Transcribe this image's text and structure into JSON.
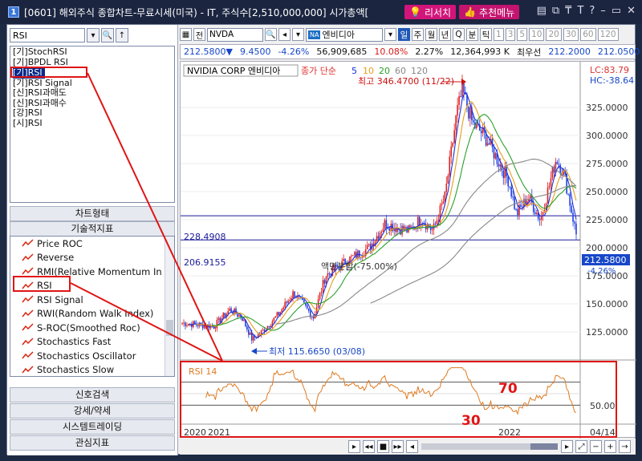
{
  "window": {
    "badge": "1",
    "title": "[0601] 해외주식 종합차트-무료시세(미국) - IT, 주식수[2,510,000,000] 시가총액[",
    "btn_research": "리서치",
    "btn_recommend": "추천메뉴",
    "icons": [
      "layout-icon",
      "copy-icon",
      "pin-icon",
      "text-size-icon",
      "help-icon",
      "minimize-icon",
      "maximize-icon",
      "close-icon"
    ]
  },
  "left_panel": {
    "search_value": "RSI",
    "indicator_list": [
      "[기]StochRSI",
      "[기]BPDL RSI",
      "[기]RSI",
      "[기]RSI Signal",
      "[신]RSI과매도",
      "[신]RSI과매수",
      "[강]RSI",
      "[시]RSI"
    ],
    "selected_index": 2,
    "btn_chart_type": "차트형태",
    "btn_technical": "기술적지표",
    "tree_items": [
      "Price ROC",
      "Reverse",
      "RMI(Relative Momentum In",
      "RSI",
      "RSI Signal",
      "RWI(Random Walk Index)",
      "S-ROC(Smoothed Roc)",
      "Stochastics Fast",
      "Stochastics Oscillator",
      "Stochastics Slow"
    ],
    "btn_signal": "신호검색",
    "btn_strength": "강세/약세",
    "btn_system": "시스템트레이딩",
    "btn_interest": "관심지표"
  },
  "toolbar": {
    "full_label": "전",
    "ticker": "NVDA",
    "name_badge": "NA",
    "name": "엔비디아",
    "periods": [
      "일",
      "주",
      "월",
      "년",
      "Q",
      "분",
      "틱"
    ],
    "active_period": "일",
    "numbers": [
      "1",
      "3",
      "5",
      "10",
      "20",
      "30",
      "60",
      "120"
    ]
  },
  "quote": {
    "price": "212.5800▼",
    "change": "9.4500",
    "change_pct": "-4.26%",
    "volume": "56,909,685",
    "vol_pct": "10.08%",
    "turnover_pct": "2.27%",
    "amount": "12,364,993 K",
    "best_bid_label": "최우선",
    "best_bid": "212.2000",
    "best_ask": "212.0500"
  },
  "chart": {
    "legend_name": "NVIDIA CORP 엔비디아",
    "legend_ma_label": "종가 단순",
    "legend_ma": [
      "5",
      "10",
      "20",
      "60",
      "120"
    ],
    "lc": "LC:83.79",
    "hc": "HC:-38.64",
    "high_label": "최고 346.4700 (11/22)",
    "low_label": "최저 115.6650 (03/08)",
    "split_label": "액면분할(-75.00%)",
    "line1_label": "228.4908",
    "line2_label": "206.9155",
    "current_price": "212.5800",
    "current_pct": "-4.26%",
    "y_ticks": [
      "325.0000",
      "300.0000",
      "275.0000",
      "250.0000",
      "225.0000",
      "200.0000",
      "175.0000",
      "150.0000",
      "125.0000"
    ],
    "rsi_label": "RSI 14",
    "rsi_tick": "50.00",
    "annot_70": "70",
    "annot_30": "30",
    "x_labels": [
      "2020",
      "2021",
      "2022"
    ],
    "x_right": "04/14"
  },
  "colors": {
    "ma5": "#1c2fd6",
    "ma10": "#e3a01b",
    "ma20": "#2aa02a",
    "ma60": "#888888",
    "up_candle": "#e02020",
    "down_candle": "#2040e0",
    "rsi_line": "#e07a20",
    "annotation": "#e01515"
  }
}
